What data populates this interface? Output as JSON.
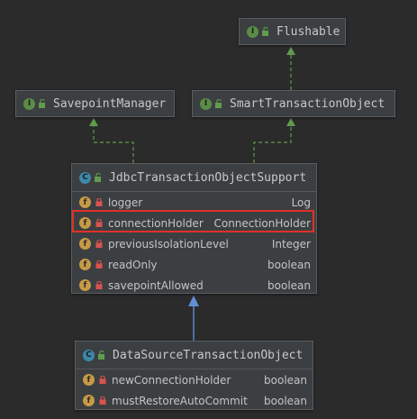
{
  "nodes": {
    "flushable": {
      "name": "Flushable",
      "badge": "I"
    },
    "savepoint_manager": {
      "name": "SavepointManager",
      "badge": "I"
    },
    "smart_transaction_object": {
      "name": "SmartTransactionObject",
      "badge": "I"
    },
    "jdbc_support": {
      "name": "JdbcTransactionObjectSupport",
      "badge": "C",
      "fields": [
        {
          "badge": "f",
          "name": "logger",
          "type": "Log"
        },
        {
          "badge": "f",
          "name": "connectionHolder",
          "type": "ConnectionHolder"
        },
        {
          "badge": "f",
          "name": "previousIsolationLevel",
          "type": "Integer"
        },
        {
          "badge": "f",
          "name": "readOnly",
          "type": "boolean"
        },
        {
          "badge": "f",
          "name": "savepointAllowed",
          "type": "boolean"
        }
      ]
    },
    "datasource_tx_object": {
      "name": "DataSourceTransactionObject",
      "badge": "C",
      "fields": [
        {
          "badge": "f",
          "name": "newConnectionHolder",
          "type": "boolean"
        },
        {
          "badge": "f",
          "name": "mustRestoreAutoCommit",
          "type": "boolean"
        }
      ]
    }
  },
  "highlighted_field": "connectionHolder",
  "colors": {
    "background": "#2b2b2b",
    "node_fill": "#3c3f41",
    "implements_edge": "#5f9c4d",
    "extends_edge": "#5f8fd6",
    "highlight": "#e0302a"
  }
}
